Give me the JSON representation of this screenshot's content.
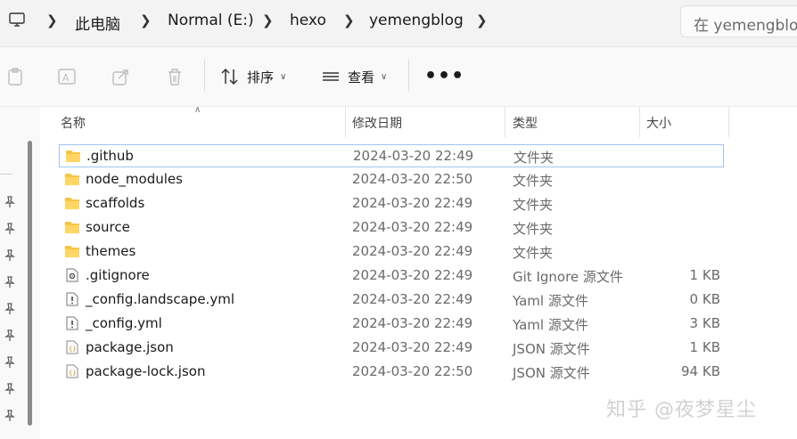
{
  "address": {
    "crumbs": [
      "此电脑",
      "Normal (E:)",
      "hexo",
      "yemengblog"
    ],
    "search_placeholder": "在 yemengblog"
  },
  "toolbar": {
    "sort_label": "排序",
    "view_label": "查看",
    "more_label": "•••"
  },
  "columns": {
    "name": "名称",
    "modified": "修改日期",
    "type": "类型",
    "size": "大小"
  },
  "files": [
    {
      "name": ".github",
      "modified": "2024-03-20 22:49",
      "type": "文件夹",
      "size": "",
      "icon": "folder-icon"
    },
    {
      "name": "node_modules",
      "modified": "2024-03-20 22:50",
      "type": "文件夹",
      "size": "",
      "icon": "folder-icon"
    },
    {
      "name": "scaffolds",
      "modified": "2024-03-20 22:49",
      "type": "文件夹",
      "size": "",
      "icon": "folder-icon"
    },
    {
      "name": "source",
      "modified": "2024-03-20 22:49",
      "type": "文件夹",
      "size": "",
      "icon": "folder-icon"
    },
    {
      "name": "themes",
      "modified": "2024-03-20 22:49",
      "type": "文件夹",
      "size": "",
      "icon": "folder-icon"
    },
    {
      "name": ".gitignore",
      "modified": "2024-03-20 22:49",
      "type": "Git Ignore 源文件",
      "size": "1 KB",
      "icon": "gear-file-icon"
    },
    {
      "name": "_config.landscape.yml",
      "modified": "2024-03-20 22:49",
      "type": "Yaml 源文件",
      "size": "0 KB",
      "icon": "exclamation-file-icon"
    },
    {
      "name": "_config.yml",
      "modified": "2024-03-20 22:49",
      "type": "Yaml 源文件",
      "size": "3 KB",
      "icon": "exclamation-file-icon"
    },
    {
      "name": "package.json",
      "modified": "2024-03-20 22:49",
      "type": "JSON 源文件",
      "size": "1 KB",
      "icon": "json-file-icon"
    },
    {
      "name": "package-lock.json",
      "modified": "2024-03-20 22:50",
      "type": "JSON 源文件",
      "size": "94 KB",
      "icon": "json-file-icon"
    }
  ],
  "watermark": "知乎 @夜梦星尘",
  "colors": {
    "folder": "#f4c542",
    "selection_border": "#9fc5ef",
    "accent": "#0067c0"
  }
}
